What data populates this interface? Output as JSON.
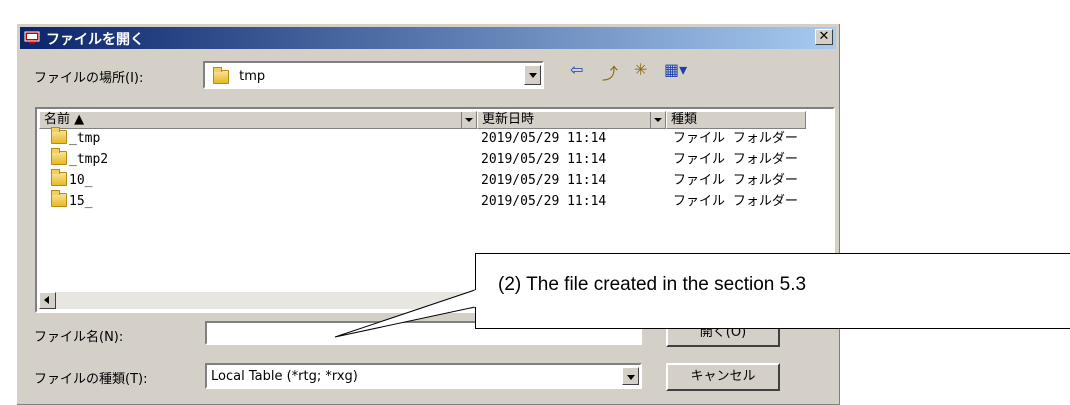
{
  "title": "ファイルを開く",
  "close_glyph": "✕",
  "lookin": {
    "label": "ファイルの場所(I):",
    "value": "tmp"
  },
  "toolbar": {
    "back": "⇦",
    "up": "⤴",
    "newfolder": "✳",
    "view": "▦▾"
  },
  "columns": [
    {
      "label": "名前 ▲"
    },
    {
      "label": "更新日時"
    },
    {
      "label": "種類"
    }
  ],
  "files": [
    {
      "name": "_tmp",
      "date": "2019/05/29 11:14",
      "type": "ファイル フォルダー"
    },
    {
      "name": "_tmp2",
      "date": "2019/05/29 11:14",
      "type": "ファイル フォルダー"
    },
    {
      "name": "10_",
      "date": "2019/05/29 11:14",
      "type": "ファイル フォルダー"
    },
    {
      "name": "15_",
      "date": "2019/05/29 11:14",
      "type": "ファイル フォルダー"
    }
  ],
  "filename": {
    "label": "ファイル名(N):",
    "value": ""
  },
  "filetype": {
    "label": "ファイルの種類(T):",
    "value": "Local Table (*rtg; *rxg)"
  },
  "buttons": {
    "open": "開く(O)",
    "cancel": "キャンセル"
  },
  "callout": "(2) The file created in the section 5.3"
}
